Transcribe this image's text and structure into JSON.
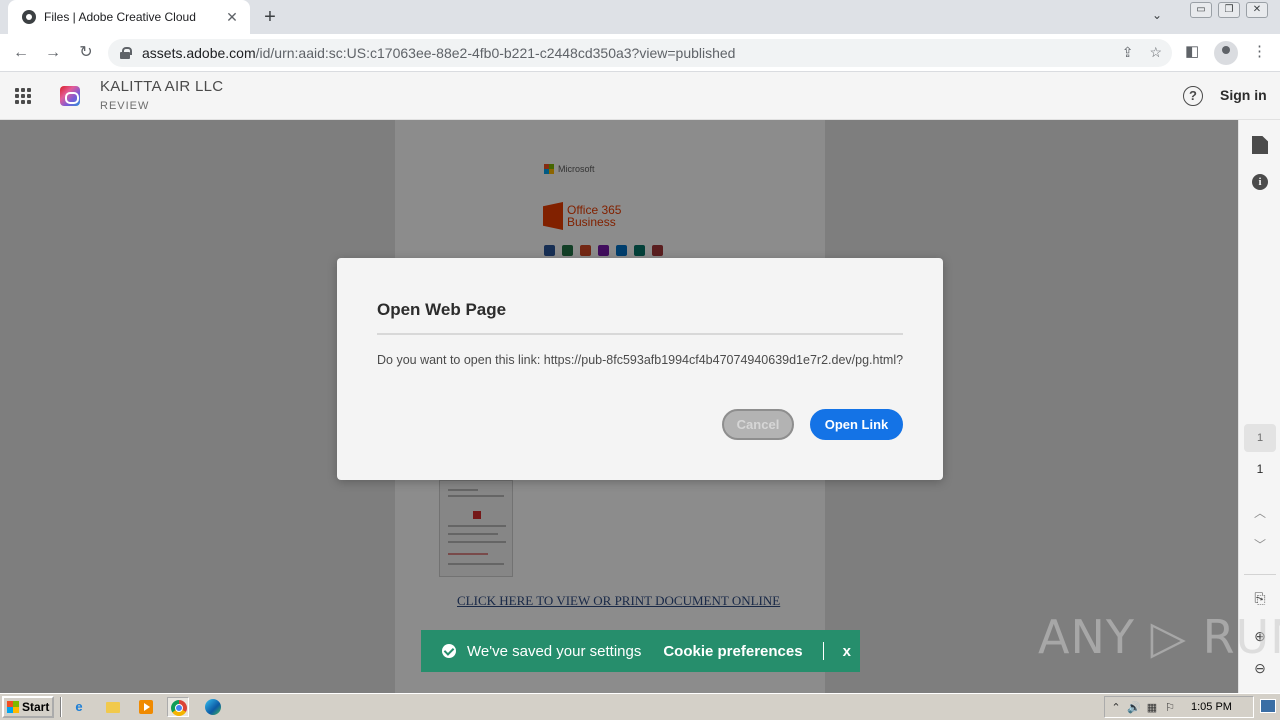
{
  "browser": {
    "tab_title": "Files | Adobe Creative Cloud",
    "tab_close": "✕",
    "new_tab": "+",
    "tab_search": "⌄",
    "window_controls": {
      "minimize": "▭",
      "restore": "❐",
      "close": "✕"
    },
    "url_host": "assets.adobe.com",
    "url_path": "/id/urn:aaid:sc:US:c17063ee-88e2-4fb0-b221-c2448cd350a3?view=published",
    "nav": {
      "back": "←",
      "forward": "→",
      "reload": "↻"
    },
    "omnibox_icons": {
      "share": "⇪",
      "bookmark": "☆"
    },
    "side_panel": "◧",
    "menu": "⋮"
  },
  "adobe": {
    "company": "KALITTA AIR LLC",
    "subtitle": "REVIEW",
    "help": "?",
    "sign_in": "Sign in"
  },
  "document": {
    "microsoft_label": "Microsoft",
    "office_line1": "Office 365",
    "office_line2": "Business",
    "app_icon_colors": [
      "#2b579a",
      "#217346",
      "#d24726",
      "#7719aa",
      "#0072c6",
      "#077568",
      "#a4373a"
    ],
    "link_text": "CLICK HERE TO VIEW OR PRINT DOCUMENT ONLINE"
  },
  "rail": {
    "info": "i",
    "current_page": "1",
    "total_pages": "1",
    "up": "︿",
    "down": "﹀",
    "zoom_in": "⊕",
    "zoom_out": "⊖",
    "page_fit": "⎘"
  },
  "modal": {
    "title": "Open Web Page",
    "body": "Do you want to open this link: https://pub-8fc593afb1994cf4b47074940639d1e7r2.dev/pg.html?",
    "cancel_label": "Cancel",
    "open_label": "Open Link"
  },
  "toast": {
    "message": "We've saved your settings",
    "preferences": "Cookie preferences",
    "close": "x"
  },
  "watermark": "ANY ▷ RUN",
  "taskbar": {
    "start_label": "Start",
    "ie_label": "e",
    "clock": "1:05 PM",
    "tray_icons": [
      "⌃",
      "🔊",
      "▦",
      "⚐"
    ]
  }
}
